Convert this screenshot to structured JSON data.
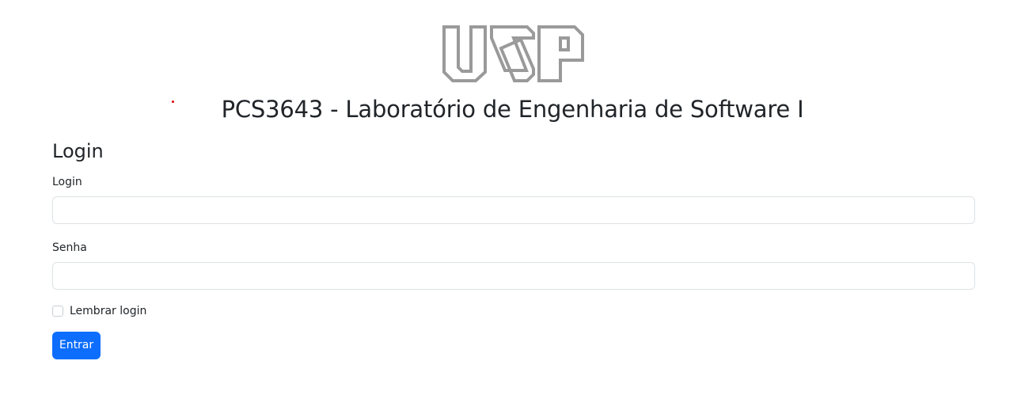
{
  "header": {
    "logo_text": "USP",
    "title": "PCS3643 - Laboratório de Engenharia de Software I"
  },
  "form": {
    "heading": "Login",
    "login_label": "Login",
    "login_value": "",
    "password_label": "Senha",
    "password_value": "",
    "remember_label": "Lembrar login",
    "remember_checked": false,
    "submit_label": "Entrar"
  },
  "colors": {
    "primary": "#0d6efd",
    "logo_gray": "#9a9a9a",
    "marker_red": "#e00000"
  }
}
